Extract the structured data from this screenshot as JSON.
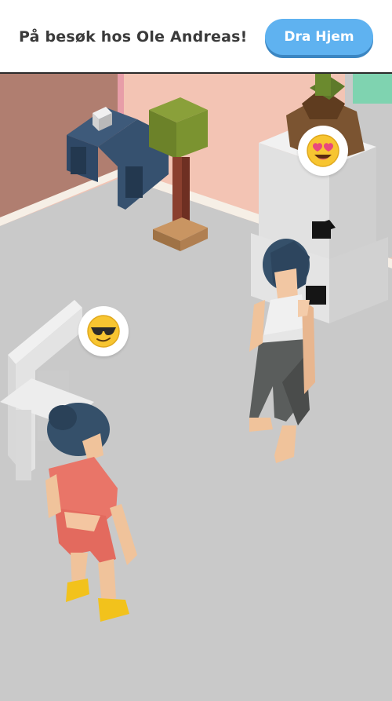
{
  "header": {
    "title": "På besøk hos Ole Andreas!",
    "home_button_label": "Dra Hjem"
  },
  "scene": {
    "characters": [
      {
        "name": "visitor",
        "emoji": "sunglasses-face"
      },
      {
        "name": "host",
        "emoji": "heart-eyes-face"
      }
    ]
  },
  "colors": {
    "button": "#5fb2f0",
    "floor": "#c9c9c9",
    "wall_pink": "#f4c3b3",
    "wall_brown": "#b07e70"
  }
}
